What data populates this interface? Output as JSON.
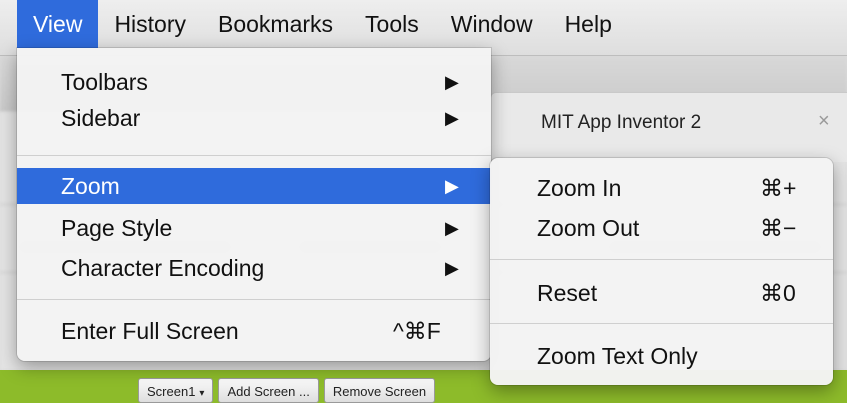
{
  "menubar": {
    "items": [
      "View",
      "History",
      "Bookmarks",
      "Tools",
      "Window",
      "Help"
    ],
    "active_index": 0
  },
  "view_menu": {
    "items": [
      {
        "label": "Toolbars",
        "submenu": true
      },
      {
        "label": "Sidebar",
        "submenu": true
      },
      {
        "label": "Zoom",
        "submenu": true,
        "highlighted": true
      },
      {
        "label": "Page Style",
        "submenu": true
      },
      {
        "label": "Character Encoding",
        "submenu": true
      },
      {
        "label": "Enter Full Screen",
        "shortcut": "^⌘F"
      }
    ],
    "submenu_arrow": "▶"
  },
  "zoom_menu": {
    "items": [
      {
        "label": "Zoom In",
        "shortcut": "⌘+"
      },
      {
        "label": "Zoom Out",
        "shortcut": "⌘−"
      },
      {
        "label": "Reset",
        "shortcut": "⌘0"
      },
      {
        "label": "Zoom Text Only"
      }
    ]
  },
  "tab": {
    "title": "MIT App Inventor 2",
    "close_icon": "×"
  },
  "bottom_buttons": {
    "screen1": "Screen1",
    "screen1_caret": "▾",
    "add_screen": "Add Screen ...",
    "remove_screen": "Remove Screen"
  },
  "colors": {
    "highlight": "#2f6bdc",
    "app_green": "#8dbb2a"
  }
}
